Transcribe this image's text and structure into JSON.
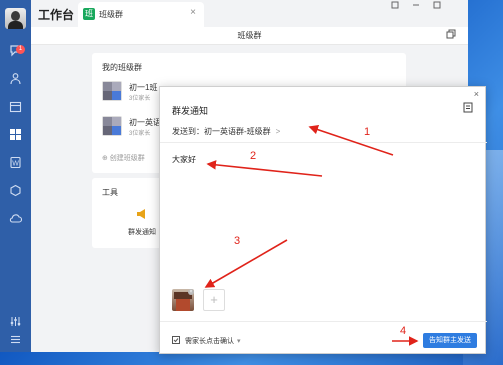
{
  "app": {
    "title": "工作台",
    "tab_label": "班级群",
    "tab_close": "×",
    "page_title": "班级群",
    "sidebar_badge": "1"
  },
  "groups_card": {
    "heading": "我的班级群",
    "groups": [
      {
        "name": "初一1班",
        "sub": "3位家长"
      },
      {
        "name": "初一英语",
        "sub": "3位家长"
      }
    ],
    "create_label": "⊕ 创建班级群"
  },
  "tools_card": {
    "heading": "工具",
    "tool_label": "群发通知"
  },
  "dialog": {
    "title": "群发通知",
    "send_to": "发送到：初一英语群-班级群",
    "send_to_arrow": ">",
    "message": "大家好",
    "add_symbol": "+",
    "need_confirm": "需家长点击确认",
    "need_confirm_caret": "▾",
    "send_button": "告知群主发送",
    "close_symbol": "×"
  },
  "annotations": [
    "1",
    "2",
    "3",
    "4"
  ],
  "colors": {
    "sidebar": "#2f5fa8",
    "accent": "#2e7ce0",
    "annotation": "#e0231a",
    "tab_icon": "#19a85c"
  }
}
